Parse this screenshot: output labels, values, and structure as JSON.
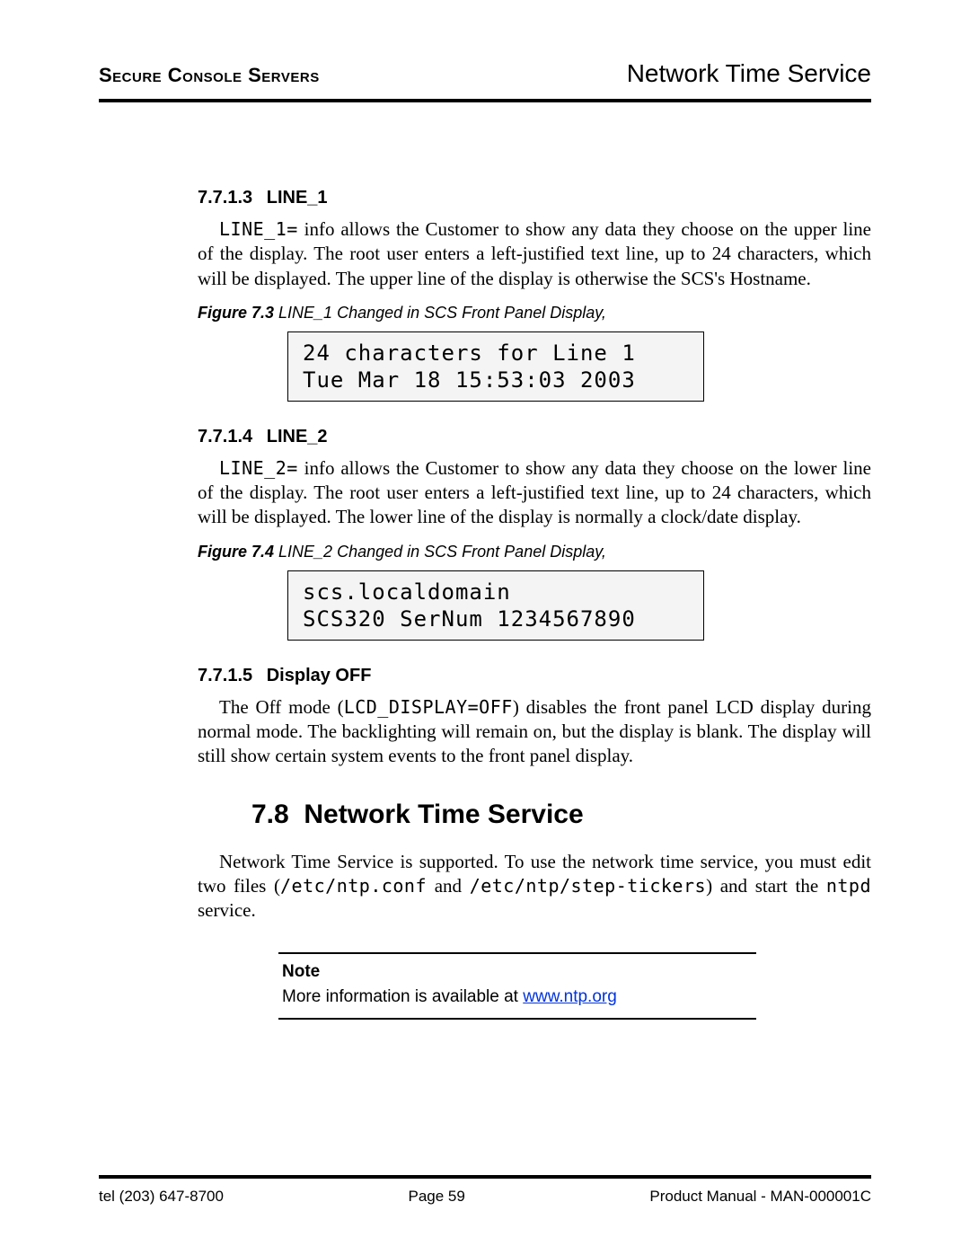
{
  "header": {
    "left": "Secure Console Servers",
    "right": "Network Time Service"
  },
  "sections": {
    "line1": {
      "num": "7.7.1.3",
      "title": "LINE_1",
      "body_lead_code": "LINE_1=",
      "body": " info allows the Customer to show any data they choose on the upper line of the display. The root user enters a left-justified text line, up to 24 characters, which will be displayed. The upper line of the display is otherwise the SCS's Hostname.",
      "fig_label": "Figure 7.3",
      "fig_caption": "  LINE_1 Changed in SCS Front Panel Display,",
      "lcd_l1": "24 characters for Line 1",
      "lcd_l2": "Tue Mar 18 15:53:03 2003"
    },
    "line2": {
      "num": "7.7.1.4",
      "title": "LINE_2",
      "body_lead_code": "LINE_2=",
      "body": " info allows the Customer to show any data they choose on the lower line of the display. The root user enters a left-justified text line, up to 24 characters, which will be displayed. The lower line of the display is normally a clock/date display.",
      "fig_label": "Figure 7.4",
      "fig_caption": "  LINE_2 Changed in SCS Front Panel Display,",
      "lcd_l1": "scs.localdomain",
      "lcd_l2": "SCS320 SerNum 1234567890"
    },
    "display_off": {
      "num": "7.7.1.5",
      "title": "Display OFF",
      "body_pre": "The Off mode (",
      "body_code": "LCD_DISPLAY=OFF",
      "body_post": ") disables the front panel LCD display during normal mode. The backlighting will remain on, but the display is blank. The display will still show certain system events to the front panel display."
    },
    "nts": {
      "num": "7.8",
      "title": "Network Time Service",
      "body_pre": "Network Time Service is supported. To use the network time service, you must edit two files (",
      "body_code1": "/etc/ntp.conf",
      "body_mid": " and ",
      "body_code2": "/etc/ntp/step-tickers",
      "body_post1": ") and start the ",
      "body_code3": "ntpd",
      "body_post2": " service."
    }
  },
  "note": {
    "label": "Note",
    "text": "More information is available at ",
    "link_text": "www.ntp.org",
    "link_href": "http://www.ntp.org"
  },
  "footer": {
    "left": "tel (203) 647-8700",
    "center": "Page 59",
    "right": "Product Manual - MAN-000001C"
  }
}
